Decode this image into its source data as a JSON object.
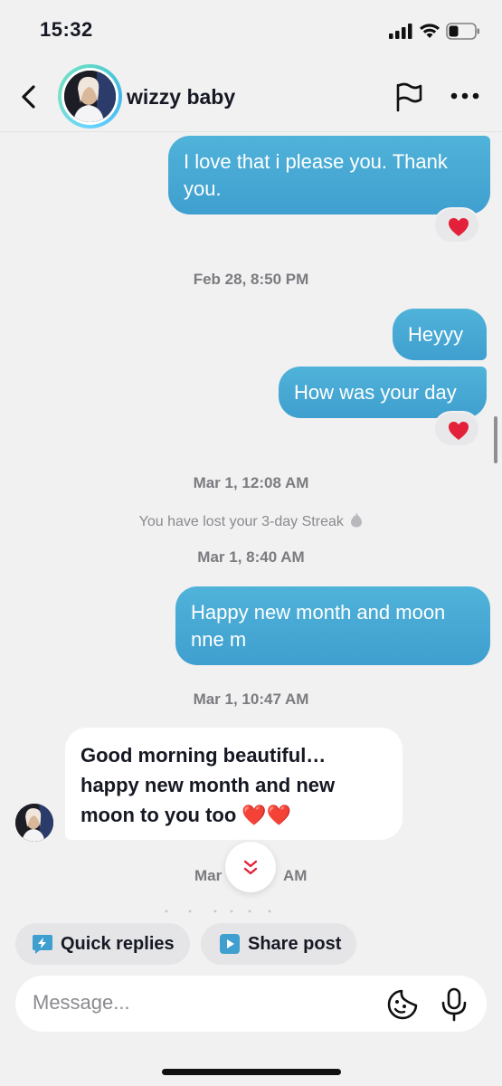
{
  "status_bar": {
    "time": "15:32"
  },
  "header": {
    "contact_name": "wizzy baby",
    "back_icon": "chevron-left-icon",
    "flag_icon": "flag-icon",
    "more_icon": "more-horizontal-icon"
  },
  "messages": {
    "m1": {
      "text": "I love that i please you. Thank you.",
      "reaction": "heart"
    },
    "ts1": "Feb 28, 8:50 PM",
    "m2": {
      "text": "Heyyy"
    },
    "m3": {
      "text": "How was your day",
      "reaction": "heart"
    },
    "ts2": "Mar 1, 12:08 AM",
    "streak_notice": "You have lost your 3-day Streak",
    "ts3": "Mar 1, 8:40 AM",
    "m4": {
      "text": "Happy new month and moon nne m"
    },
    "ts4": "Mar 1, 10:47 AM",
    "m5": {
      "text": "Good morning beautiful… happy new month and new moon to you too ❤️❤️"
    },
    "ts5_left": "Mar",
    "ts5_right": "AM"
  },
  "quick_actions": {
    "quick_replies": "Quick replies",
    "share_post": "Share post"
  },
  "composer": {
    "placeholder": "Message..."
  },
  "colors": {
    "outgoing_bubble": "#4aaad6",
    "background": "#f1f1f2",
    "heart": "#e3213a"
  }
}
